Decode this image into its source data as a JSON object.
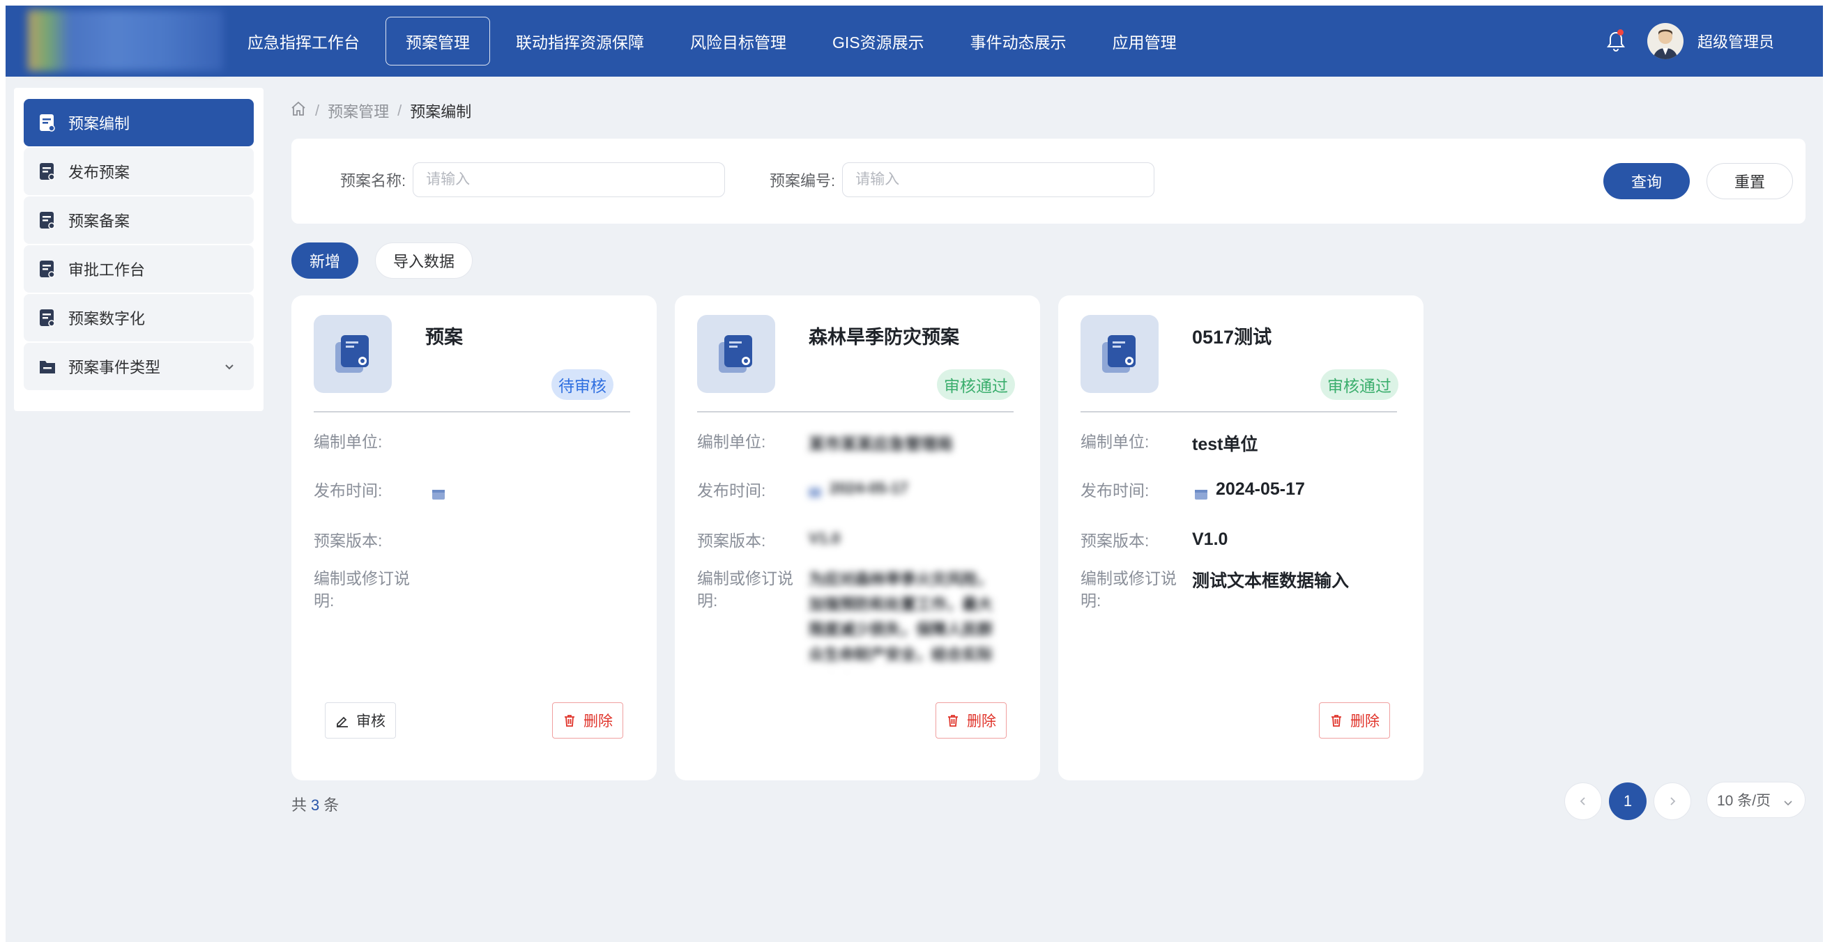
{
  "header": {
    "nav": [
      {
        "label": "应急指挥工作台",
        "active": false
      },
      {
        "label": "预案管理",
        "active": true
      },
      {
        "label": "联动指挥资源保障",
        "active": false
      },
      {
        "label": "风险目标管理",
        "active": false
      },
      {
        "label": "GIS资源展示",
        "active": false
      },
      {
        "label": "事件动态展示",
        "active": false
      },
      {
        "label": "应用管理",
        "active": false
      }
    ],
    "user_name": "超级管理员"
  },
  "sidebar": {
    "items": [
      {
        "label": "预案编制",
        "active": true
      },
      {
        "label": "发布预案"
      },
      {
        "label": "预案备案"
      },
      {
        "label": "审批工作台"
      },
      {
        "label": "预案数字化"
      },
      {
        "label": "预案事件类型",
        "expandable": true
      }
    ]
  },
  "breadcrumb": {
    "sep": "/",
    "items": [
      "预案管理",
      "预案编制"
    ]
  },
  "search": {
    "name_label": "预案名称:",
    "name_placeholder": "请输入",
    "code_label": "预案编号:",
    "code_placeholder": "请输入",
    "query_label": "查询",
    "reset_label": "重置"
  },
  "toolbar": {
    "add_label": "新增",
    "import_label": "导入数据"
  },
  "field_labels": {
    "unit": "编制单位:",
    "publish_time": "发布时间:",
    "version": "预案版本:",
    "note": "编制或修订说明:"
  },
  "cards": [
    {
      "title": "预案",
      "status": "待审核",
      "unit": "",
      "publish_time": "",
      "version": "",
      "note": "",
      "audit_label": "审核",
      "delete_label": "删除"
    },
    {
      "title": "森林旱季防灾预案",
      "status": "审核通过",
      "unit": "某市某某应急管理局",
      "publish_time": "2024-05-17",
      "version": "V1.0",
      "note": "为应对森林旱季火灾风险，加强预防和处置工作，最大限度减少损失，保障人民群众生命财产安全，结合实际制定本预案。",
      "delete_label": "删除"
    },
    {
      "title": "0517测试",
      "status": "审核通过",
      "unit": "test单位",
      "publish_time": "2024-05-17",
      "version": "V1.0",
      "note": "测试文本框数据输入",
      "delete_label": "删除"
    }
  ],
  "pagination": {
    "total_prefix": "共",
    "total": "3",
    "total_suffix": "条",
    "current_page": "1",
    "page_size": "10 条/页"
  },
  "colors": {
    "primary": "#2855a8",
    "pending": "#2f6fe0",
    "pass": "#3bae6d",
    "danger": "#e0342b"
  }
}
